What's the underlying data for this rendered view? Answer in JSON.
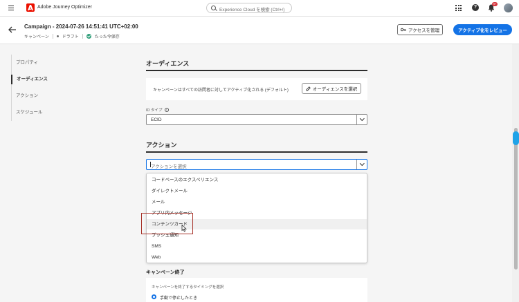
{
  "topbar": {
    "app_name": "Adobe Journey Optimizer",
    "search_placeholder": "Experience Cloud を検索 (Ctrl+/)",
    "notification_count": "9+"
  },
  "header": {
    "title": "Campaign - 2024-07-26 14:51:41 UTC+02:00",
    "type": "キャンペーン",
    "status": "ドラフト",
    "save_state": "たった今保存",
    "access_button": "アクセスを管理",
    "review_button": "アクティブ化をレビュー"
  },
  "nav": {
    "items": [
      {
        "label": "プロパティ",
        "active": false
      },
      {
        "label": "オーディエンス",
        "active": true
      },
      {
        "label": "アクション",
        "active": false
      },
      {
        "label": "スケジュール",
        "active": false
      }
    ]
  },
  "audience": {
    "title": "オーディエンス",
    "description": "キャンペーンはすべての訪問者に対してアクティブ化される (デフォルト)",
    "select_button": "オーディエンスを選択",
    "id_type_label": "ID タイプ",
    "id_type_value": "ECID"
  },
  "action": {
    "title": "アクション",
    "placeholder": "アクションを選択",
    "options": [
      "コードベースのエクスペリエンス",
      "ダイレクトメール",
      "メール",
      "アプリ内メッセージ",
      "コンテンツカード",
      "プッシュ通知",
      "SMS",
      "Web"
    ],
    "hovered_index": 4
  },
  "end": {
    "title": "キャンペーン終了",
    "subtitle": "キャンペーンを終了するタイミングを選択",
    "option": "手動で停止したとき"
  },
  "colors": {
    "accent": "#1473e6",
    "adobe_red": "#eb1000",
    "highlight": "#a63128"
  }
}
